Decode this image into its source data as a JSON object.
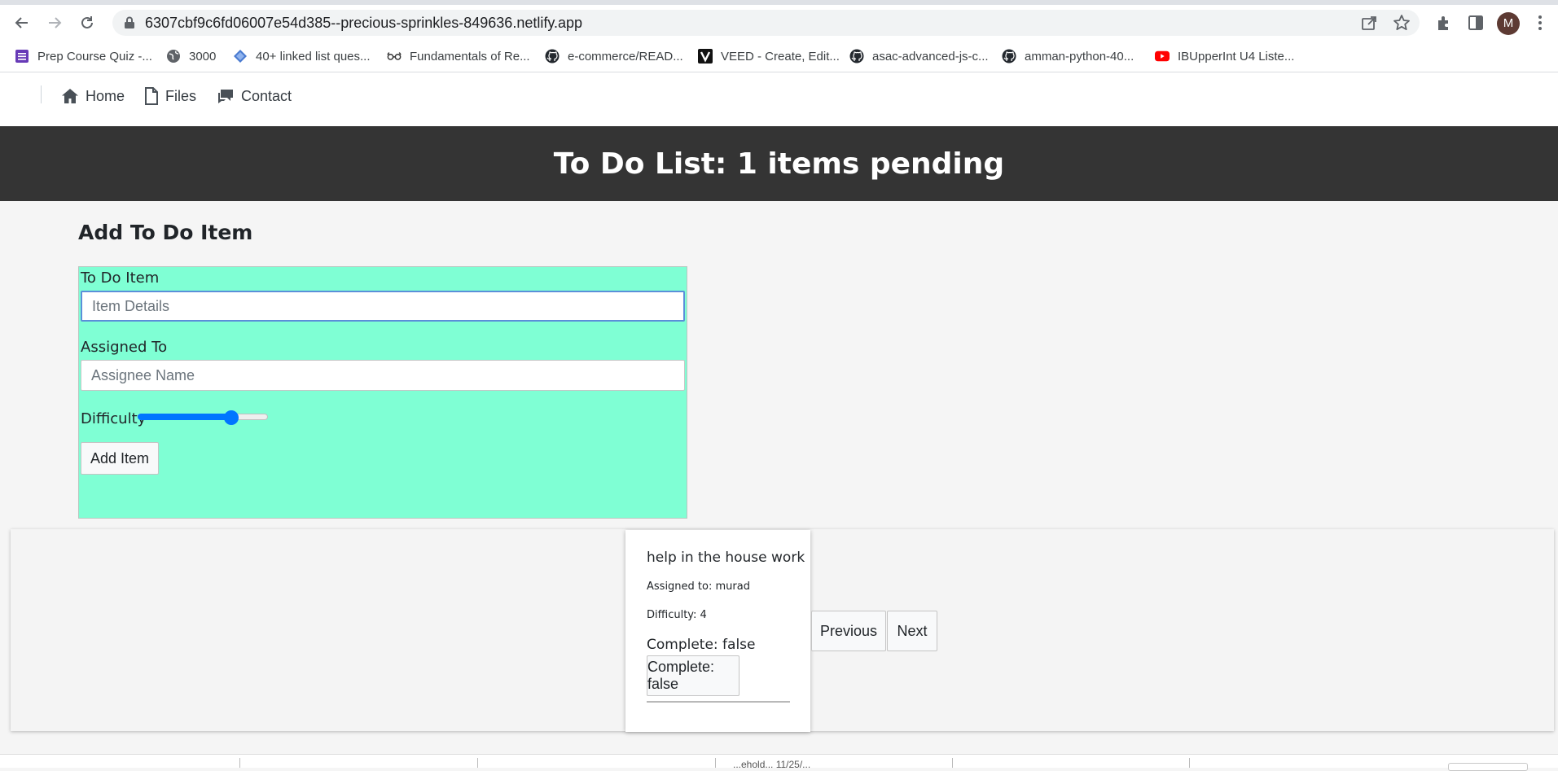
{
  "browser": {
    "url": "6307cbf9c6fd06007e54d385--precious-sprinkles-849636.netlify.app",
    "profile_initial": "M",
    "bookmarks": [
      {
        "label": "Prep Course Quiz -...",
        "icon": "quiz-icon"
      },
      {
        "label": "3000",
        "icon": "globe-icon"
      },
      {
        "label": "40+ linked list ques...",
        "icon": "diamond-icon"
      },
      {
        "label": "Fundamentals of Re...",
        "icon": "glasses-icon"
      },
      {
        "label": "e-commerce/READ...",
        "icon": "github-icon"
      },
      {
        "label": "VEED - Create, Edit...",
        "icon": "veed-icon"
      },
      {
        "label": "asac-advanced-js-c...",
        "icon": "github-icon"
      },
      {
        "label": "amman-python-40...",
        "icon": "github-icon"
      },
      {
        "label": "IBUpperInt U4 Liste...",
        "icon": "youtube-icon"
      }
    ]
  },
  "nav": {
    "home": "Home",
    "files": "Files",
    "contact": "Contact"
  },
  "header": {
    "title": "To Do List: 1 items pending"
  },
  "form": {
    "title": "Add To Do Item",
    "item_label": "To Do Item",
    "item_placeholder": "Item Details",
    "assignee_label": "Assigned To",
    "assignee_placeholder": "Assignee Name",
    "difficulty_label": "Difficulty",
    "difficulty_fraction": 0.72,
    "submit_label": "Add Item"
  },
  "todo": {
    "text": "help in the house work",
    "assigned": "Assigned to: murad",
    "difficulty": "Difficulty: 4",
    "complete_text": "Complete: false",
    "complete_button": "Complete: false"
  },
  "pagination": {
    "previous": "Previous",
    "next": "Next"
  },
  "footer": {
    "text": "...ehold... 11/25/..."
  },
  "colors": {
    "banner": "#343434",
    "form_bg": "#7fffd4",
    "slider": "#0075ff"
  }
}
